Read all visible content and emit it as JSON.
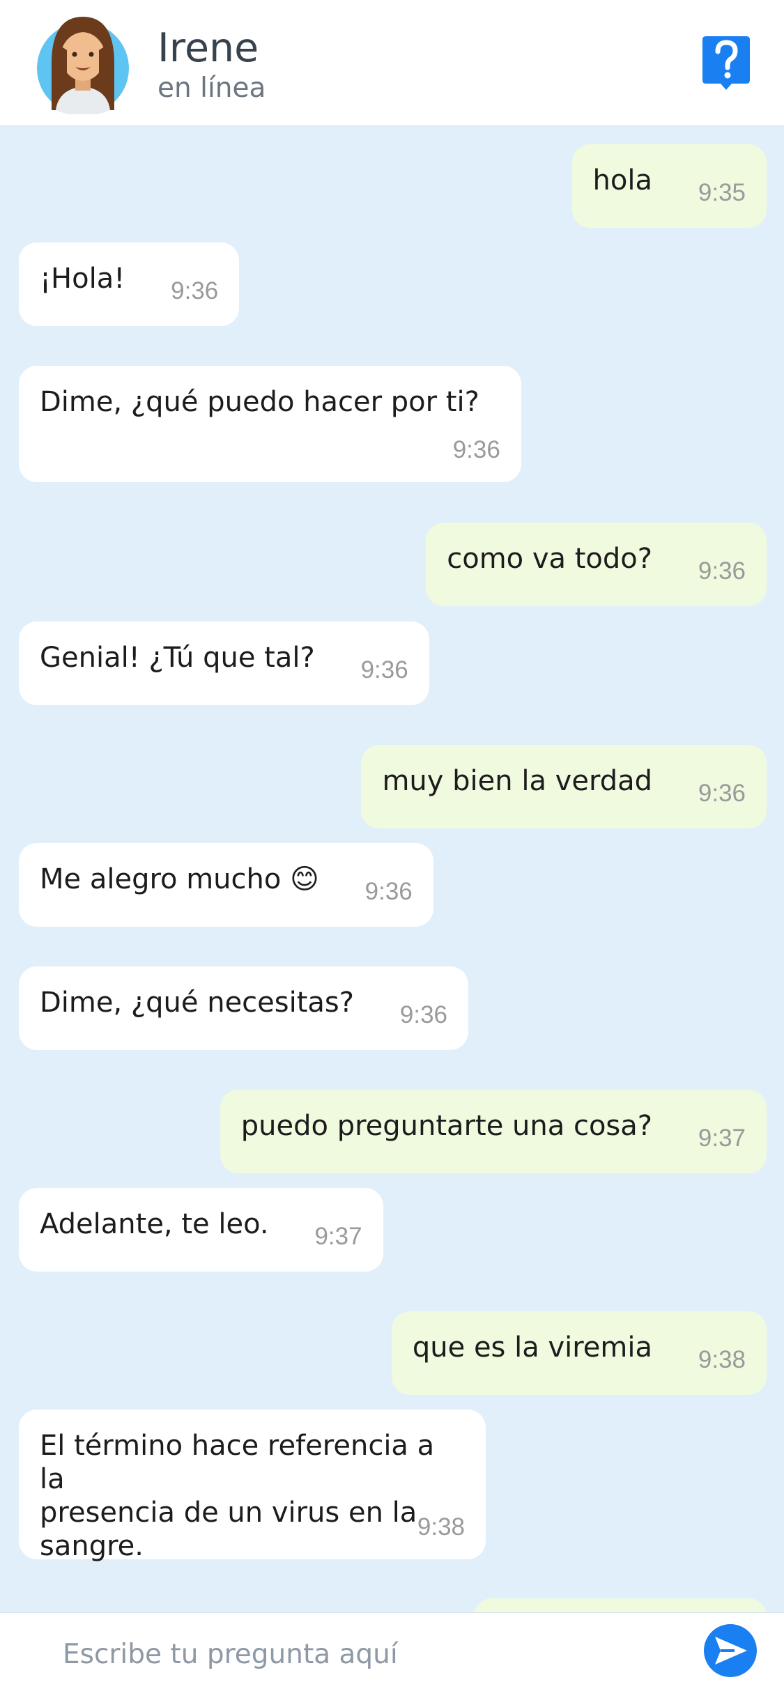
{
  "header": {
    "name": "Irene",
    "status": "en línea",
    "help_icon": "question-mark-icon"
  },
  "messages": [
    {
      "from": "user",
      "text": "hola",
      "time": "9:35"
    },
    {
      "from": "bot",
      "text": "¡Hola!",
      "time": "9:36"
    },
    {
      "from": "bot",
      "text": "Dime, ¿qué puedo hacer por ti?",
      "time": "9:36"
    },
    {
      "from": "user",
      "text": "como va todo?",
      "time": "9:36"
    },
    {
      "from": "bot",
      "text": "Genial! ¿Tú que tal?",
      "time": "9:36"
    },
    {
      "from": "user",
      "text": "muy bien la verdad",
      "time": "9:36"
    },
    {
      "from": "bot",
      "text": "Me alegro mucho 😊",
      "time": "9:36"
    },
    {
      "from": "bot",
      "text": "Dime, ¿qué necesitas?",
      "time": "9:36"
    },
    {
      "from": "user",
      "text": "puedo preguntarte una cosa?",
      "time": "9:37"
    },
    {
      "from": "bot",
      "text": "Adelante, te leo.",
      "time": "9:37"
    },
    {
      "from": "user",
      "text": "que es la viremia",
      "time": "9:38"
    },
    {
      "from": "bot",
      "text": "El término hace referencia a la\npresencia de un virus en la\nsangre.",
      "time": "9:38"
    }
  ],
  "composer": {
    "placeholder": "Escribe tu pregunta aquí",
    "send_icon": "send-arrow-icon"
  },
  "colors": {
    "chat_background": "#e1effb",
    "incoming_bubble": "#ffffff",
    "outgoing_bubble": "#f0fadf",
    "accent": "#1a7ff1"
  }
}
